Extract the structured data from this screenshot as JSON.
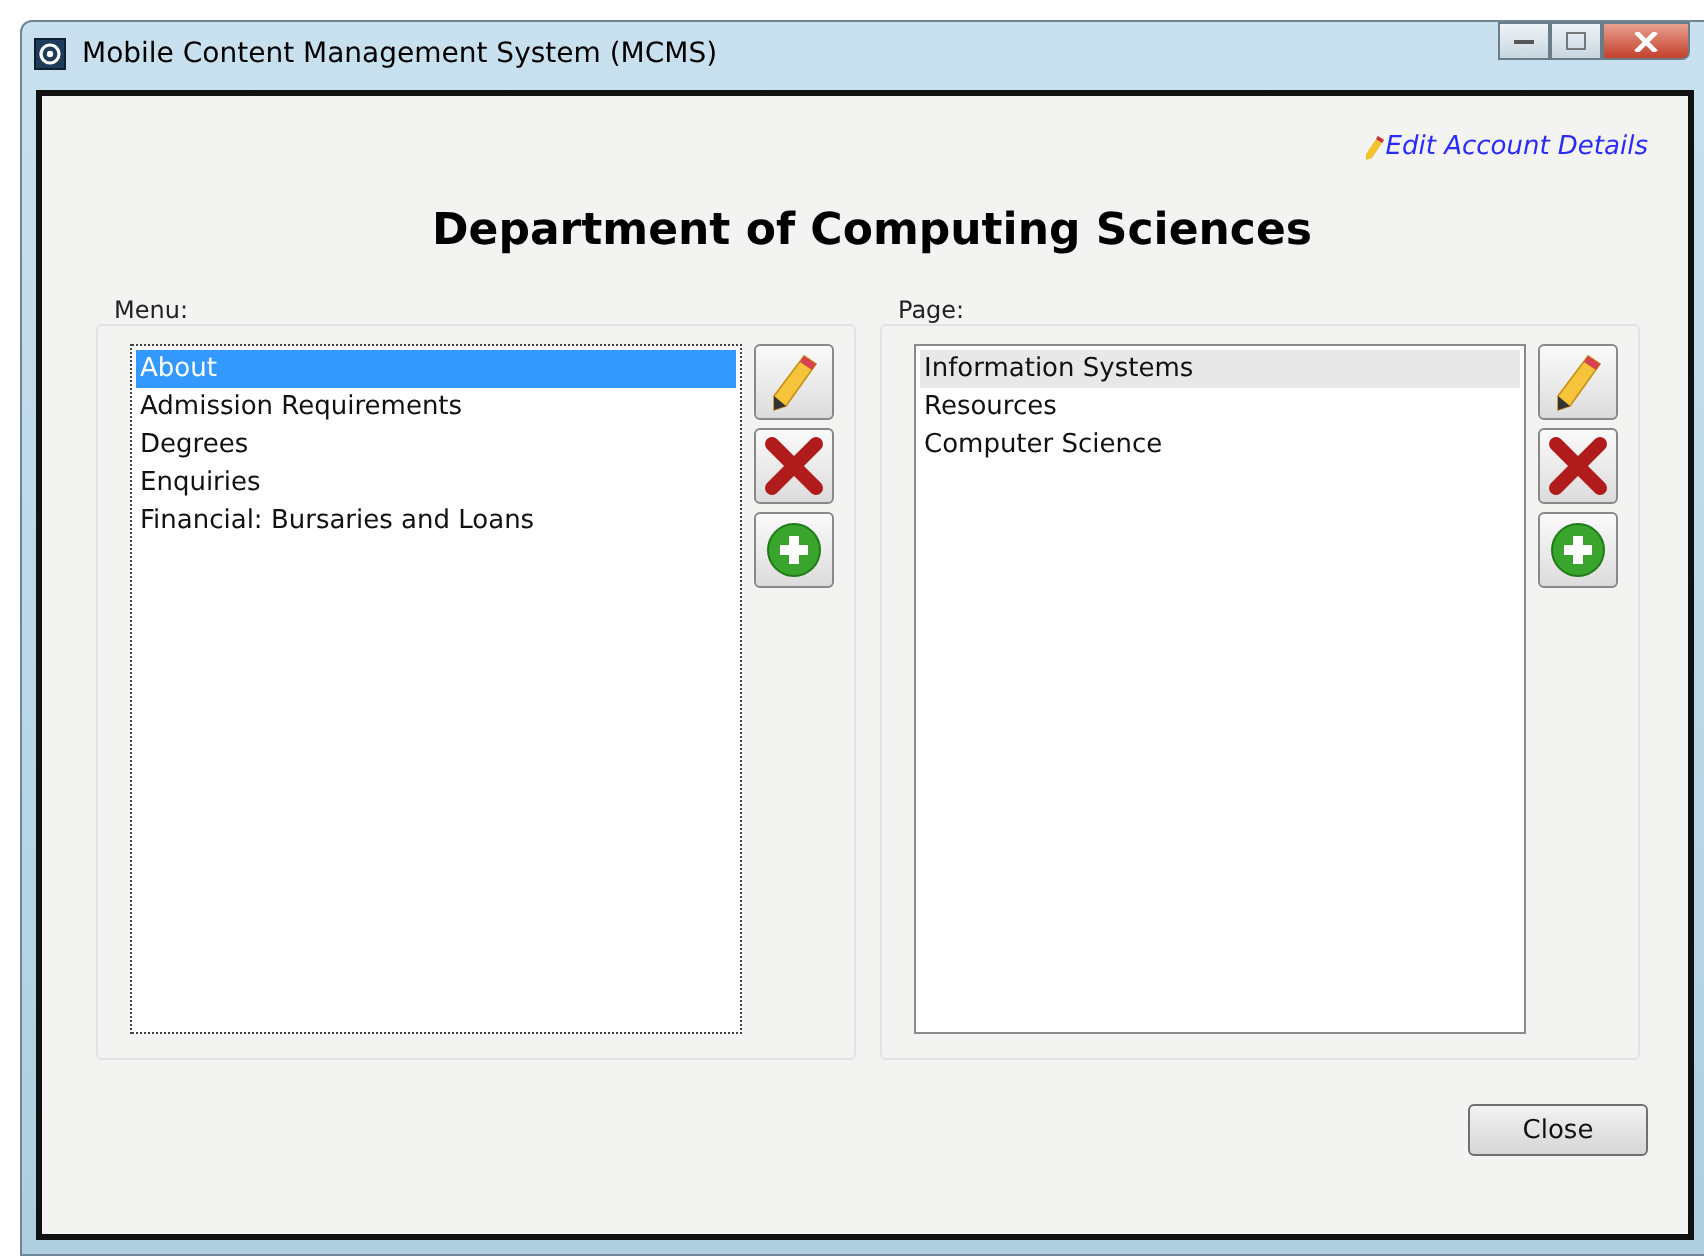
{
  "window": {
    "title": "Mobile Content Management System (MCMS)"
  },
  "account_link": "Edit Account Details",
  "heading": "Department of Computing Sciences",
  "lists": [
    {
      "label": "Menu:",
      "focused": true,
      "items": [
        {
          "text": "About",
          "selected": true
        },
        {
          "text": "Admission Requirements",
          "selected": false
        },
        {
          "text": "Degrees",
          "selected": false
        },
        {
          "text": "Enquiries",
          "selected": false
        },
        {
          "text": "Financial: Bursaries and Loans",
          "selected": false
        }
      ]
    },
    {
      "label": "Page:",
      "focused": false,
      "items": [
        {
          "text": "Information Systems",
          "selected": true
        },
        {
          "text": "Resources",
          "selected": false
        },
        {
          "text": "Computer Science",
          "selected": false
        }
      ]
    }
  ],
  "close_button": "Close"
}
